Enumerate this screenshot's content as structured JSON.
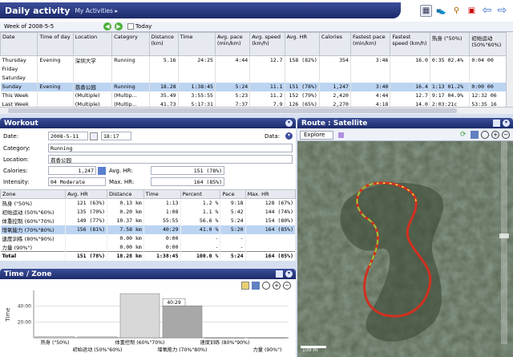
{
  "app": {
    "title": "Daily activity",
    "subtitle": "My Activities"
  },
  "toolbar": {
    "today_label": "Today",
    "week_label": "Week of 2008-5-5"
  },
  "grid": {
    "headers": [
      "Date",
      "Time of day",
      "Location",
      "Category",
      "Distance (km)",
      "Time",
      "Avg. pace (min/km)",
      "Avg. speed (km/h)",
      "Avg. HR",
      "Calories",
      "Fastest pace (min/km)",
      "Fastest speed (km/h)",
      "热身 (\"50%)",
      "初始运动 (50%\"60%)"
    ],
    "rows": [
      [
        "Thursday",
        "Evening",
        "深圳大学",
        "Running",
        "5.16",
        "24:25",
        "4:44",
        "12.7",
        "158 (82%)",
        "354",
        "3:46",
        "16.0",
        "0:35  02.4%",
        "0:04  00"
      ],
      [
        "Friday",
        "",
        "",
        "",
        "",
        "",
        "",
        "",
        "",
        "",
        "",
        "",
        "",
        ""
      ],
      [
        "Saturday",
        "",
        "",
        "",
        "",
        "",
        "",
        "",
        "",
        "",
        "",
        "",
        "",
        ""
      ],
      [
        "Sunday",
        "Evening",
        "荔香公园",
        "Running",
        "18.28",
        "1:38:45",
        "5:24",
        "11.1",
        "151 (78%)",
        "1,247",
        "3:40",
        "16.4",
        "1:13  01.2%",
        "0:00  00"
      ],
      [
        "This Week",
        "",
        "(Multiple)",
        "(Multip...",
        "35.49",
        "3:55:55",
        "5:23",
        "11.2",
        "152 (79%)",
        "2,420",
        "4:44",
        "12.7",
        "9:17  04.9%",
        "12:32  06"
      ],
      [
        "Last Week",
        "",
        "(Multiple)",
        "(Multip...",
        "41.73",
        "5:17:31",
        "7:37",
        "7.9",
        "126 (65%)",
        "2,270",
        "4:18",
        "14.0",
        "2:03:21c",
        "53:35  16"
      ]
    ]
  },
  "workout": {
    "title": "Workout",
    "date_label": "Date:",
    "date": "2008-5-11",
    "time": "18:17",
    "data_label": "Data:",
    "category_label": "Category:",
    "category": "Running",
    "location_label": "Location:",
    "location": "荔香公园",
    "calories_label": "Calories:",
    "calories": "1,247",
    "avghr_label": "Avg. HR:",
    "avghr": "151 (78%)",
    "intensity_label": "Intensity:",
    "intensity": "04 Moderate",
    "maxhr_label": "Max. HR:",
    "maxhr": "164 (85%)"
  },
  "zones": {
    "headers": [
      "Zone",
      "Avg. HR",
      "Distance",
      "Time",
      "Percent",
      "Pace",
      "Max. HR"
    ],
    "rows": [
      [
        "热身 (\"50%)",
        "121  (63%)",
        "0.13  km",
        "1:13",
        "1.2 %",
        "9:18",
        "128  (67%)"
      ],
      [
        "初始运动 (50%\"60%)",
        "135  (70%)",
        "0.20  km",
        "1:08",
        "1.1 %",
        "5:42",
        "144  (74%)"
      ],
      [
        "体重控制 (60%\"70%)",
        "149  (77%)",
        "10.37  km",
        "55:55",
        "56.6 %",
        "5:24",
        "154  (80%)"
      ],
      [
        "增氧能力 (70%\"80%)",
        "156  (81%)",
        "7.58  km",
        "40:29",
        "41.0 %",
        "5:20",
        "164  (85%)"
      ],
      [
        "速度训练 (80%\"90%)",
        "",
        "0.00  km",
        "0:00",
        "-",
        "-",
        ""
      ],
      [
        "力量 (90%\")",
        "",
        "0.00  km",
        "0:00",
        "-",
        "-",
        ""
      ]
    ],
    "total": [
      "Total",
      "151  (78%)",
      "18.28  km",
      "1:38:45",
      "100.0 %",
      "5:24",
      "164  (85%)"
    ]
  },
  "timezone": {
    "title": "Time / Zone",
    "ylabel": "Time",
    "ticks": [
      "40:00",
      "20:00"
    ],
    "tooltip": "40:29",
    "xlabels_top": [
      "热身 (\"50%)",
      "体重控制 (60%\"70%)",
      "速度训练 (80%\"90%)"
    ],
    "xlabels_bottom": [
      "初始运动 (50%\"60%)",
      "增氧能力 (70%\"80%)",
      "力量 (90%\")"
    ]
  },
  "chart_data": {
    "type": "bar",
    "categories": [
      "热身 (\"50%)",
      "初始运动 (50%\"60%)",
      "体重控制 (60%\"70%)",
      "增氧能力 (70%\"80%)",
      "速度训练 (80%\"90%)",
      "力量 (90%\")"
    ],
    "values": [
      1.2,
      1.1,
      55.9,
      40.5,
      0,
      0
    ],
    "ylabel": "Time",
    "ylim": [
      0,
      60
    ]
  },
  "map": {
    "title": "Route : Satellite",
    "explore_label": "Explore",
    "scale": "100 m"
  }
}
